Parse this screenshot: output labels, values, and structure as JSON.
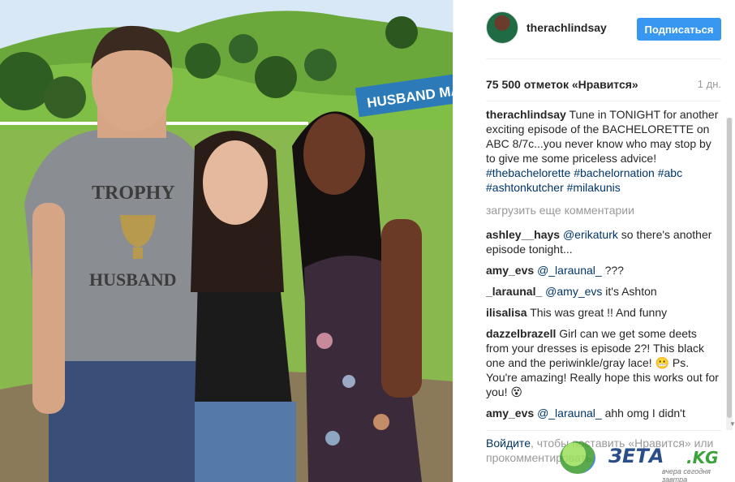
{
  "post": {
    "username": "therachlindsay",
    "follow_label": "Подписаться",
    "likes": "75 500 отметок «Нравится»",
    "age": "1 дн."
  },
  "photo": {
    "banner_text": "HUSBAND MA",
    "shirt_line1": "TROPHY",
    "shirt_line2": "HUSBAND"
  },
  "caption": {
    "user": "therachlindsay",
    "text": "Tune in TONIGHT for another exciting episode of the BACHELORETTE on ABC 8/7c...you never know who may stop by to give me some priceless advice!",
    "tags": [
      "#thebachelorette",
      "#bachelornation",
      "#abc",
      "#ashtonkutcher",
      "#milakunis"
    ]
  },
  "load_more": "загрузить еще комментарии",
  "comments": [
    {
      "user": "ashley__hays",
      "mention": "@erikaturk",
      "text": "so there's another episode tonight..."
    },
    {
      "user": "amy_evs",
      "mention": "@_laraunal_",
      "text": "???"
    },
    {
      "user": "_laraunal_",
      "mention": "@amy_evs",
      "text": "it's Ashton"
    },
    {
      "user": "ilisalisa",
      "mention": "",
      "text": "This was great !! And funny"
    },
    {
      "user": "dazzelbrazell",
      "mention": "",
      "text": "Girl can we get some deets from your dresses is episode 2?! This black one and the periwinkle/gray lace! 😬 Ps. You're amazing! Really hope this works out for you! 😵"
    },
    {
      "user": "amy_evs",
      "mention": "@_laraunal_",
      "text": "ahh omg I didn't"
    }
  ],
  "footer": {
    "login": "Войдите",
    "rest": ", чтобы поставить «Нравится» или прокомментировать."
  },
  "watermark": {
    "name": "ЗЕТА",
    "suffix": ".KG",
    "slogan": "вчера сегодня завтра"
  },
  "colors": {
    "follow": "#3897f0",
    "link": "#003569",
    "muted": "#999999"
  },
  "icons": [
    "avatar",
    "scroll-arrow-icon",
    "watermark-globe-icon"
  ]
}
